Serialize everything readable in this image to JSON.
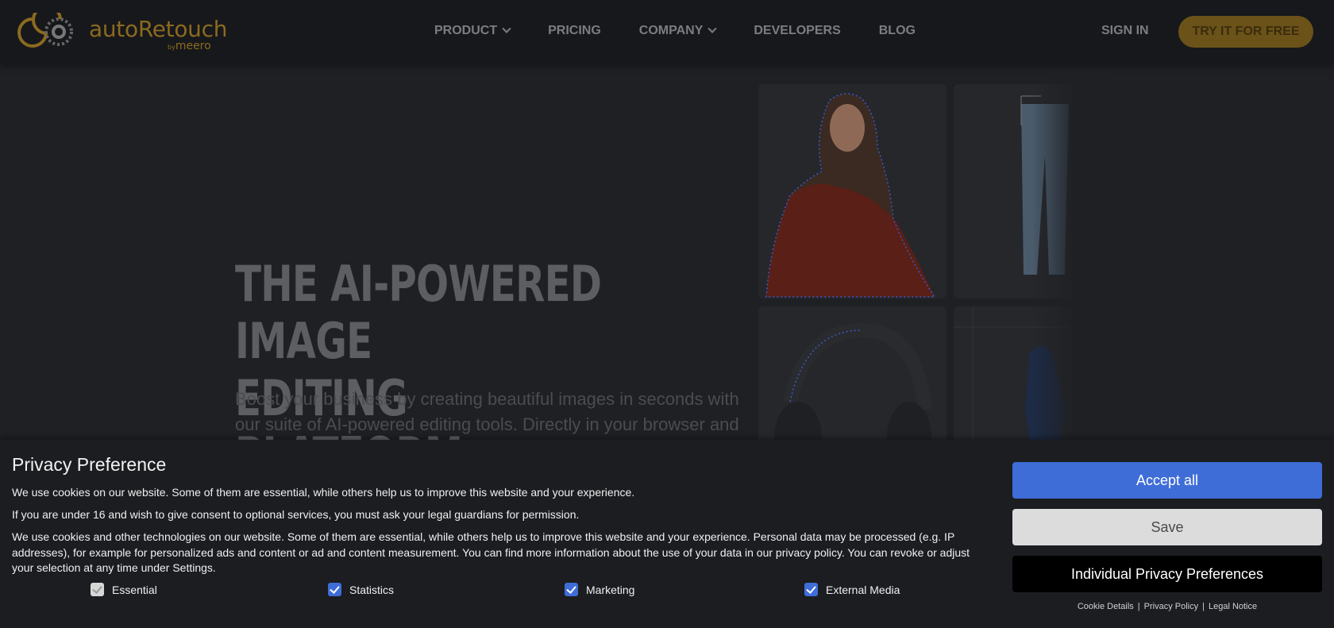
{
  "brand": {
    "name": "autoRetouch",
    "by": "by",
    "byName": "meero",
    "accent": "#8b6a20"
  },
  "nav": {
    "items": [
      {
        "label": "PRODUCT",
        "dropdown": true
      },
      {
        "label": "PRICING",
        "dropdown": false
      },
      {
        "label": "COMPANY",
        "dropdown": true
      },
      {
        "label": "DEVELOPERS",
        "dropdown": false
      },
      {
        "label": "BLOG",
        "dropdown": false
      }
    ],
    "signin": "SIGN IN",
    "cta": "TRY IT FOR FREE"
  },
  "hero": {
    "title_line1": "THE AI-POWERED IMAGE",
    "title_line2": "EDITING PLATFORM",
    "subtitle": "Boost your business by creating beautiful images in seconds with our suite of AI-powered editing tools. Directly in your browser and via API."
  },
  "consent": {
    "title": "Privacy Preference",
    "p1": "We use cookies on our website. Some of them are essential, while others help us to improve this website and your experience.",
    "p2": "If you are under 16 and wish to give consent to optional services, you must ask your legal guardians for permission.",
    "p3": "We use cookies and other technologies on our website. Some of them are essential, while others help us to improve this website and your experience. Personal data may be processed (e.g. IP addresses), for example for personalized ads and content or ad and content measurement. You can find more information about the use of your data in our privacy policy. You can revoke or adjust your selection at any time under Settings.",
    "options": [
      {
        "label": "Essential",
        "checked": true,
        "disabled": true
      },
      {
        "label": "Statistics",
        "checked": true,
        "disabled": false
      },
      {
        "label": "Marketing",
        "checked": true,
        "disabled": false
      },
      {
        "label": "External Media",
        "checked": true,
        "disabled": false
      }
    ],
    "accept_label": "Accept all",
    "save_label": "Save",
    "individual_label": "Individual Privacy Preferences",
    "links": [
      "Cookie Details",
      "Privacy Policy",
      "Legal Notice"
    ],
    "link_separator": "|",
    "accept_color": "#3f6dd8"
  }
}
